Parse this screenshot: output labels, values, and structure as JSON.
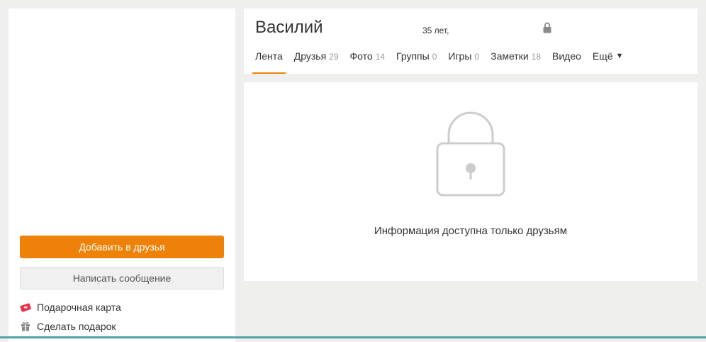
{
  "sidebar": {
    "add_friend_label": "Добавить в друзья",
    "message_label": "Написать сообщение",
    "links": [
      {
        "label": "Подарочная карта",
        "icon": "gift-card-icon"
      },
      {
        "label": "Сделать подарок",
        "icon": "gift-icon"
      }
    ]
  },
  "profile": {
    "name": "Василий",
    "age": "35 лет,"
  },
  "tabs": [
    {
      "label": "Лента",
      "count": "",
      "active": true
    },
    {
      "label": "Друзья",
      "count": "29"
    },
    {
      "label": "Фото",
      "count": "14"
    },
    {
      "label": "Группы",
      "count": "0"
    },
    {
      "label": "Игры",
      "count": "0"
    },
    {
      "label": "Заметки",
      "count": "18"
    },
    {
      "label": "Видео",
      "count": ""
    },
    {
      "label": "Ещё",
      "count": "",
      "dropdown": true
    }
  ],
  "content": {
    "private_message": "Информация доступна только друзьям"
  },
  "colors": {
    "accent": "#ee8208",
    "background": "#efefed",
    "lock_gray": "#cccccc"
  }
}
